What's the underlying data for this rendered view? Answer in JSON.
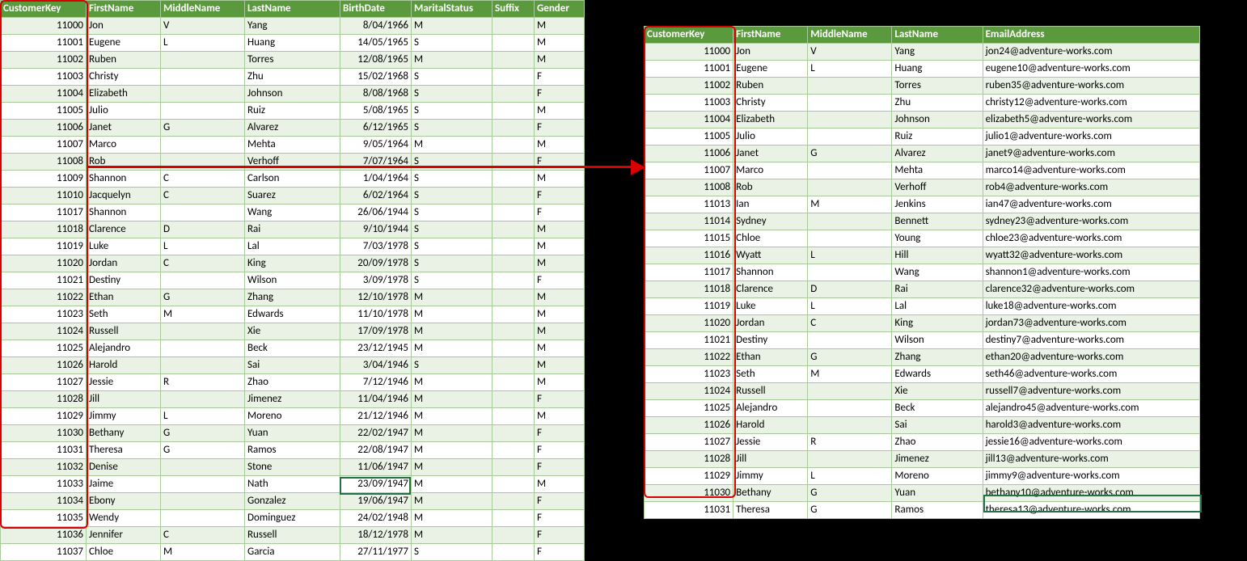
{
  "leftTable": {
    "headers": [
      "CustomerKey",
      "FirstName",
      "MiddleName",
      "LastName",
      "BirthDate",
      "MaritalStatus",
      "Suffix",
      "Gender"
    ],
    "rows": [
      [
        "11000",
        "Jon",
        "V",
        "Yang",
        "8/04/1966",
        "M",
        "",
        "M"
      ],
      [
        "11001",
        "Eugene",
        "L",
        "Huang",
        "14/05/1965",
        "S",
        "",
        "M"
      ],
      [
        "11002",
        "Ruben",
        "",
        "Torres",
        "12/08/1965",
        "M",
        "",
        "M"
      ],
      [
        "11003",
        "Christy",
        "",
        "Zhu",
        "15/02/1968",
        "S",
        "",
        "F"
      ],
      [
        "11004",
        "Elizabeth",
        "",
        "Johnson",
        "8/08/1968",
        "S",
        "",
        "F"
      ],
      [
        "11005",
        "Julio",
        "",
        "Ruiz",
        "5/08/1965",
        "S",
        "",
        "M"
      ],
      [
        "11006",
        "Janet",
        "G",
        "Alvarez",
        "6/12/1965",
        "S",
        "",
        "F"
      ],
      [
        "11007",
        "Marco",
        "",
        "Mehta",
        "9/05/1964",
        "M",
        "",
        "M"
      ],
      [
        "11008",
        "Rob",
        "",
        "Verhoff",
        "7/07/1964",
        "S",
        "",
        "F"
      ],
      [
        "11009",
        "Shannon",
        "C",
        "Carlson",
        "1/04/1964",
        "S",
        "",
        "M"
      ],
      [
        "11010",
        "Jacquelyn",
        "C",
        "Suarez",
        "6/02/1964",
        "S",
        "",
        "F"
      ],
      [
        "11017",
        "Shannon",
        "",
        "Wang",
        "26/06/1944",
        "S",
        "",
        "F"
      ],
      [
        "11018",
        "Clarence",
        "D",
        "Rai",
        "9/10/1944",
        "S",
        "",
        "M"
      ],
      [
        "11019",
        "Luke",
        "L",
        "Lal",
        "7/03/1978",
        "S",
        "",
        "M"
      ],
      [
        "11020",
        "Jordan",
        "C",
        "King",
        "20/09/1978",
        "S",
        "",
        "M"
      ],
      [
        "11021",
        "Destiny",
        "",
        "Wilson",
        "3/09/1978",
        "S",
        "",
        "F"
      ],
      [
        "11022",
        "Ethan",
        "G",
        "Zhang",
        "12/10/1978",
        "M",
        "",
        "M"
      ],
      [
        "11023",
        "Seth",
        "M",
        "Edwards",
        "11/10/1978",
        "M",
        "",
        "M"
      ],
      [
        "11024",
        "Russell",
        "",
        "Xie",
        "17/09/1978",
        "M",
        "",
        "M"
      ],
      [
        "11025",
        "Alejandro",
        "",
        "Beck",
        "23/12/1945",
        "M",
        "",
        "M"
      ],
      [
        "11026",
        "Harold",
        "",
        "Sai",
        "3/04/1946",
        "S",
        "",
        "M"
      ],
      [
        "11027",
        "Jessie",
        "R",
        "Zhao",
        "7/12/1946",
        "M",
        "",
        "M"
      ],
      [
        "11028",
        "Jill",
        "",
        "Jimenez",
        "11/04/1946",
        "M",
        "",
        "F"
      ],
      [
        "11029",
        "Jimmy",
        "L",
        "Moreno",
        "21/12/1946",
        "M",
        "",
        "M"
      ],
      [
        "11030",
        "Bethany",
        "G",
        "Yuan",
        "22/02/1947",
        "M",
        "",
        "F"
      ],
      [
        "11031",
        "Theresa",
        "G",
        "Ramos",
        "22/08/1947",
        "M",
        "",
        "F"
      ],
      [
        "11032",
        "Denise",
        "",
        "Stone",
        "11/06/1947",
        "M",
        "",
        "F"
      ],
      [
        "11033",
        "Jaime",
        "",
        "Nath",
        "23/09/1947",
        "M",
        "",
        "M"
      ],
      [
        "11034",
        "Ebony",
        "",
        "Gonzalez",
        "19/06/1947",
        "M",
        "",
        "F"
      ],
      [
        "11035",
        "Wendy",
        "",
        "Dominguez",
        "24/02/1948",
        "M",
        "",
        "F"
      ],
      [
        "11036",
        "Jennifer",
        "C",
        "Russell",
        "18/12/1978",
        "M",
        "",
        "F"
      ],
      [
        "11037",
        "Chloe",
        "M",
        "Garcia",
        "27/11/1977",
        "S",
        "",
        "F"
      ]
    ]
  },
  "rightTable": {
    "headers": [
      "CustomerKey",
      "FirstName",
      "MiddleName",
      "LastName",
      "EmailAddress"
    ],
    "rows": [
      [
        "11000",
        "Jon",
        "V",
        "Yang",
        "jon24@adventure-works.com"
      ],
      [
        "11001",
        "Eugene",
        "L",
        "Huang",
        "eugene10@adventure-works.com"
      ],
      [
        "11002",
        "Ruben",
        "",
        "Torres",
        "ruben35@adventure-works.com"
      ],
      [
        "11003",
        "Christy",
        "",
        "Zhu",
        "christy12@adventure-works.com"
      ],
      [
        "11004",
        "Elizabeth",
        "",
        "Johnson",
        "elizabeth5@adventure-works.com"
      ],
      [
        "11005",
        "Julio",
        "",
        "Ruiz",
        "julio1@adventure-works.com"
      ],
      [
        "11006",
        "Janet",
        "G",
        "Alvarez",
        "janet9@adventure-works.com"
      ],
      [
        "11007",
        "Marco",
        "",
        "Mehta",
        "marco14@adventure-works.com"
      ],
      [
        "11008",
        "Rob",
        "",
        "Verhoff",
        "rob4@adventure-works.com"
      ],
      [
        "11013",
        "Ian",
        "M",
        "Jenkins",
        "ian47@adventure-works.com"
      ],
      [
        "11014",
        "Sydney",
        "",
        "Bennett",
        "sydney23@adventure-works.com"
      ],
      [
        "11015",
        "Chloe",
        "",
        "Young",
        "chloe23@adventure-works.com"
      ],
      [
        "11016",
        "Wyatt",
        "L",
        "Hill",
        "wyatt32@adventure-works.com"
      ],
      [
        "11017",
        "Shannon",
        "",
        "Wang",
        "shannon1@adventure-works.com"
      ],
      [
        "11018",
        "Clarence",
        "D",
        "Rai",
        "clarence32@adventure-works.com"
      ],
      [
        "11019",
        "Luke",
        "L",
        "Lal",
        "luke18@adventure-works.com"
      ],
      [
        "11020",
        "Jordan",
        "C",
        "King",
        "jordan73@adventure-works.com"
      ],
      [
        "11021",
        "Destiny",
        "",
        "Wilson",
        "destiny7@adventure-works.com"
      ],
      [
        "11022",
        "Ethan",
        "G",
        "Zhang",
        "ethan20@adventure-works.com"
      ],
      [
        "11023",
        "Seth",
        "M",
        "Edwards",
        "seth46@adventure-works.com"
      ],
      [
        "11024",
        "Russell",
        "",
        "Xie",
        "russell7@adventure-works.com"
      ],
      [
        "11025",
        "Alejandro",
        "",
        "Beck",
        "alejandro45@adventure-works.com"
      ],
      [
        "11026",
        "Harold",
        "",
        "Sai",
        "harold3@adventure-works.com"
      ],
      [
        "11027",
        "Jessie",
        "R",
        "Zhao",
        "jessie16@adventure-works.com"
      ],
      [
        "11028",
        "Jill",
        "",
        "Jimenez",
        "jill13@adventure-works.com"
      ],
      [
        "11029",
        "Jimmy",
        "L",
        "Moreno",
        "jimmy9@adventure-works.com"
      ],
      [
        "11030",
        "Bethany",
        "G",
        "Yuan",
        "bethany10@adventure-works.com"
      ],
      [
        "11031",
        "Theresa",
        "G",
        "Ramos",
        "theresa13@adventure-works.com"
      ]
    ]
  },
  "chart_data": {
    "type": "table",
    "title": "Two customer tables linked by CustomerKey",
    "left_columns": [
      "CustomerKey",
      "FirstName",
      "MiddleName",
      "LastName",
      "BirthDate",
      "MaritalStatus",
      "Suffix",
      "Gender"
    ],
    "right_columns": [
      "CustomerKey",
      "FirstName",
      "MiddleName",
      "LastName",
      "EmailAddress"
    ]
  }
}
